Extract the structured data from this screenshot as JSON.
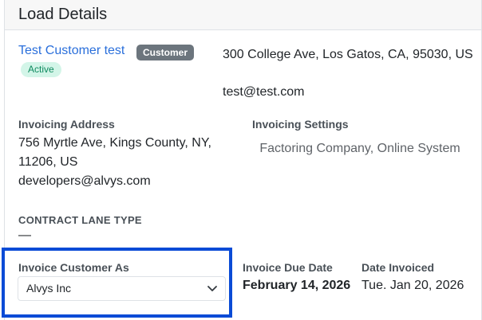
{
  "card": {
    "title": "Load Details"
  },
  "customer": {
    "name": "Test Customer test",
    "type_badge": "Customer",
    "status_badge": "Active",
    "address": "300 College Ave, Los Gatos, CA, 95030, US",
    "email": "test@test.com"
  },
  "invoicing_address": {
    "label": "Invoicing Address",
    "address": "756 Myrtle Ave, Kings County, NY, 11206, US",
    "email": "developers@alvys.com"
  },
  "invoicing_settings": {
    "label": "Invoicing Settings",
    "value": "Factoring Company, Online System"
  },
  "contract_lane_type": {
    "label": "CONTRACT LANE TYPE",
    "value": "—"
  },
  "invoice_customer_as": {
    "label": "Invoice Customer As",
    "selected": "Alvys Inc"
  },
  "invoice_due_date": {
    "label": "Invoice Due Date",
    "value": "February 14, 2026"
  },
  "date_invoiced": {
    "label": "Date Invoiced",
    "value": "Tue. Jan 20, 2026"
  },
  "colors": {
    "link": "#2a6fdb",
    "highlight_border": "#0a4bd6",
    "badge_customer_bg": "#6c757d",
    "badge_active_bg": "#d3f5e8",
    "badge_active_text": "#0f8a5f"
  }
}
